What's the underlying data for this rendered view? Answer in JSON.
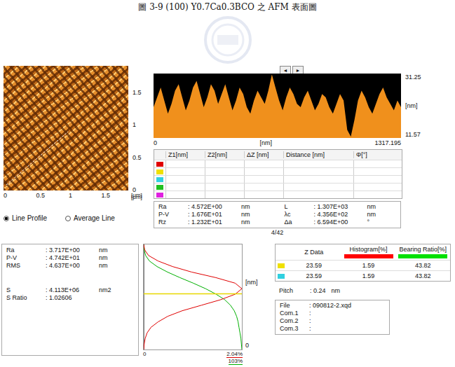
{
  "caption": "圖 3-9 (100) Y0.7Ca0.3BCO 之 AFM 表面圖",
  "image": {
    "y_ticks": [
      "0",
      "0.5",
      "1",
      "1.5"
    ],
    "x_ticks": [
      "0",
      "0.5",
      "1",
      "1.5"
    ],
    "y_unit": "[μm]",
    "x_unit": "[μm]"
  },
  "profile": {
    "nav_buttons": [
      "◄",
      "►"
    ],
    "y_max": "31.25",
    "y_min": "11.57",
    "y_unit": "[nm]",
    "x_start": "0",
    "x_unit": "[nm]",
    "x_end": "1317.195",
    "values": [
      21,
      24,
      27,
      23,
      19,
      22,
      26,
      28,
      24,
      20,
      23,
      27,
      29,
      25,
      21,
      24,
      28,
      26,
      22,
      25,
      28,
      24,
      20,
      23,
      27,
      25,
      21,
      19,
      23,
      26,
      24,
      22,
      26,
      31,
      27,
      23,
      20,
      24,
      27,
      25,
      22,
      21,
      24,
      26,
      23,
      20,
      22,
      25,
      24,
      21,
      19,
      22,
      25,
      23,
      14,
      12,
      17,
      23,
      26,
      24,
      21,
      19,
      22,
      25,
      27,
      24,
      22,
      20,
      23,
      21
    ]
  },
  "cursor_table": {
    "columns": [
      "Z1[nm]",
      "Z2[nm]",
      "ΔZ [nm]",
      "Distance [nm]",
      "Φ[°]"
    ],
    "rows": [
      {
        "color": "#e00000",
        "cells": [
          "",
          "",
          "",
          "",
          ""
        ]
      },
      {
        "color": "#f0e000",
        "cells": [
          "",
          "",
          "",
          "",
          ""
        ]
      },
      {
        "color": "#30d0e0",
        "cells": [
          "",
          "",
          "",
          "",
          ""
        ]
      },
      {
        "color": "#20c020",
        "cells": [
          "",
          "",
          "",
          "",
          ""
        ]
      },
      {
        "color": "#e020e0",
        "cells": [
          "",
          "",
          "",
          "",
          ""
        ]
      }
    ]
  },
  "mode": [
    {
      "label": "Line Profile",
      "selected": true
    },
    {
      "label": "Average Line",
      "selected": false
    }
  ],
  "line_stats": {
    "left": [
      {
        "label": "Ra",
        "value": ": 4.572E+00",
        "unit": "nm"
      },
      {
        "label": "P-V",
        "value": ": 1.676E+01",
        "unit": "nm"
      },
      {
        "label": "Rz",
        "value": ": 1.232E+01",
        "unit": "nm"
      }
    ],
    "right": [
      {
        "label": "L",
        "value": ": 1.307E+03",
        "unit": "nm"
      },
      {
        "label": "λc",
        "value": ": 4.356E+02",
        "unit": "nm"
      },
      {
        "label": "Δa",
        "value": ": 6.594E+00",
        "unit": "°"
      }
    ]
  },
  "page": "4/42",
  "area_stats": [
    [
      {
        "label": "Ra",
        "value": ": 3.717E+00",
        "unit": "nm"
      },
      {
        "label": "P-V",
        "value": ": 4.742E+01",
        "unit": "nm"
      },
      {
        "label": "RMS",
        "value": ": 4.637E+00",
        "unit": "nm"
      }
    ],
    [
      {
        "label": "S",
        "value": ": 4.113E+06",
        "unit": "nm2"
      },
      {
        "label": "S Ratio",
        "value": ": 1.02606",
        "unit": ""
      }
    ]
  ],
  "histogram": {
    "unit": "[nm]",
    "bottom": "0",
    "left": "0",
    "hist_max": "2.04%",
    "bearing_max": "103%",
    "cursor_level": 0.47,
    "histogram": [
      0,
      0.02,
      0.1,
      0.3,
      0.6,
      1.0,
      1.5,
      1.9,
      2.04,
      1.9,
      1.6,
      1.2,
      0.8,
      0.5,
      0.3,
      0.15,
      0.07,
      0.03,
      0.01,
      0
    ],
    "bearing": [
      0,
      0.5,
      2,
      6,
      14,
      25,
      38,
      52,
      65,
      76,
      85,
      91,
      95,
      97.5,
      99,
      100,
      101,
      102,
      102.5,
      103
    ]
  },
  "z_table": {
    "columns": [
      {
        "label": "Z Data",
        "color": ""
      },
      {
        "label": "Histogram[%]",
        "color": "#ff0000"
      },
      {
        "label": "Bearing Ratio[%]",
        "color": "#00e000"
      }
    ],
    "rows": [
      {
        "color": "#f0e000",
        "cells": [
          "23.59",
          "1.59",
          "43.82"
        ]
      },
      {
        "color": "#30d0e0",
        "cells": [
          "23.59",
          "1.59",
          "43.82"
        ]
      }
    ]
  },
  "pitch": {
    "label": "Pitch",
    "value": ": 0.24",
    "unit": "nm"
  },
  "file": [
    {
      "label": "File",
      "value": ": 090812-2.xqd"
    },
    {
      "label": "Com.1",
      "value": ":"
    },
    {
      "label": "Com.2",
      "value": ":"
    },
    {
      "label": "Com.3",
      "value": ":"
    }
  ]
}
